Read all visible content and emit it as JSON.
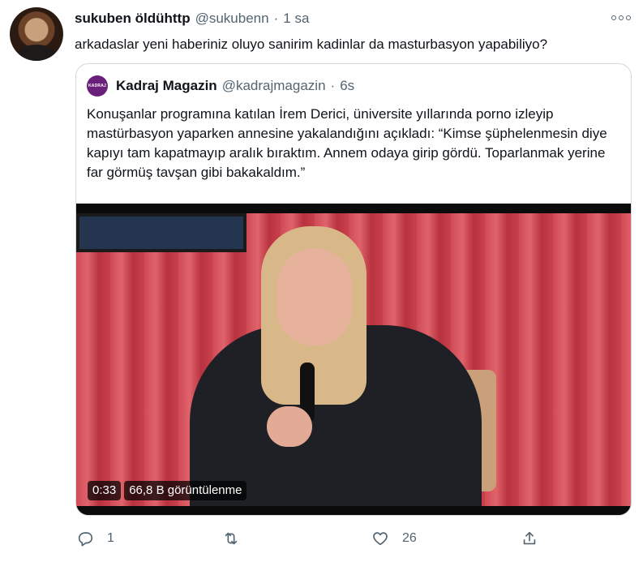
{
  "tweet": {
    "display_name": "sukuben öldühttp",
    "handle": "@sukubenn",
    "separator": "·",
    "time": "1 sa",
    "text": "arkadaslar yeni haberiniz oluyo sanirim kadinlar da masturbasyon yapabiliyo?",
    "more_icon": "more-horizontal-icon"
  },
  "quote": {
    "avatar_text": "KADRAJ",
    "display_name": "Kadraj Magazin",
    "handle": "@kadrajmagazin",
    "separator": "·",
    "time": "6s",
    "text": "Konuşanlar programına katılan İrem Derici, üniversite yıllarında porno izleyip mastürbasyon yaparken annesine yakalandığını açıkladı: “Kimse şüphelenmesin diye kapıyı tam kapatmayıp aralık bıraktım. Annem odaya girip gördü. Toparlanmak yerine far görmüş tavşan gibi bakakaldım.”",
    "video": {
      "duration": "0:33",
      "views": "66,8 B görüntülenme"
    }
  },
  "actions": {
    "reply_count": "1",
    "retweet_count": "",
    "like_count": "26",
    "icons": [
      "reply-icon",
      "retweet-icon",
      "like-icon",
      "share-icon"
    ]
  },
  "colors": {
    "text_primary": "#0f1419",
    "text_secondary": "#536471",
    "border": "#cfd9de",
    "brand_avatar": "#6a1f7a"
  }
}
